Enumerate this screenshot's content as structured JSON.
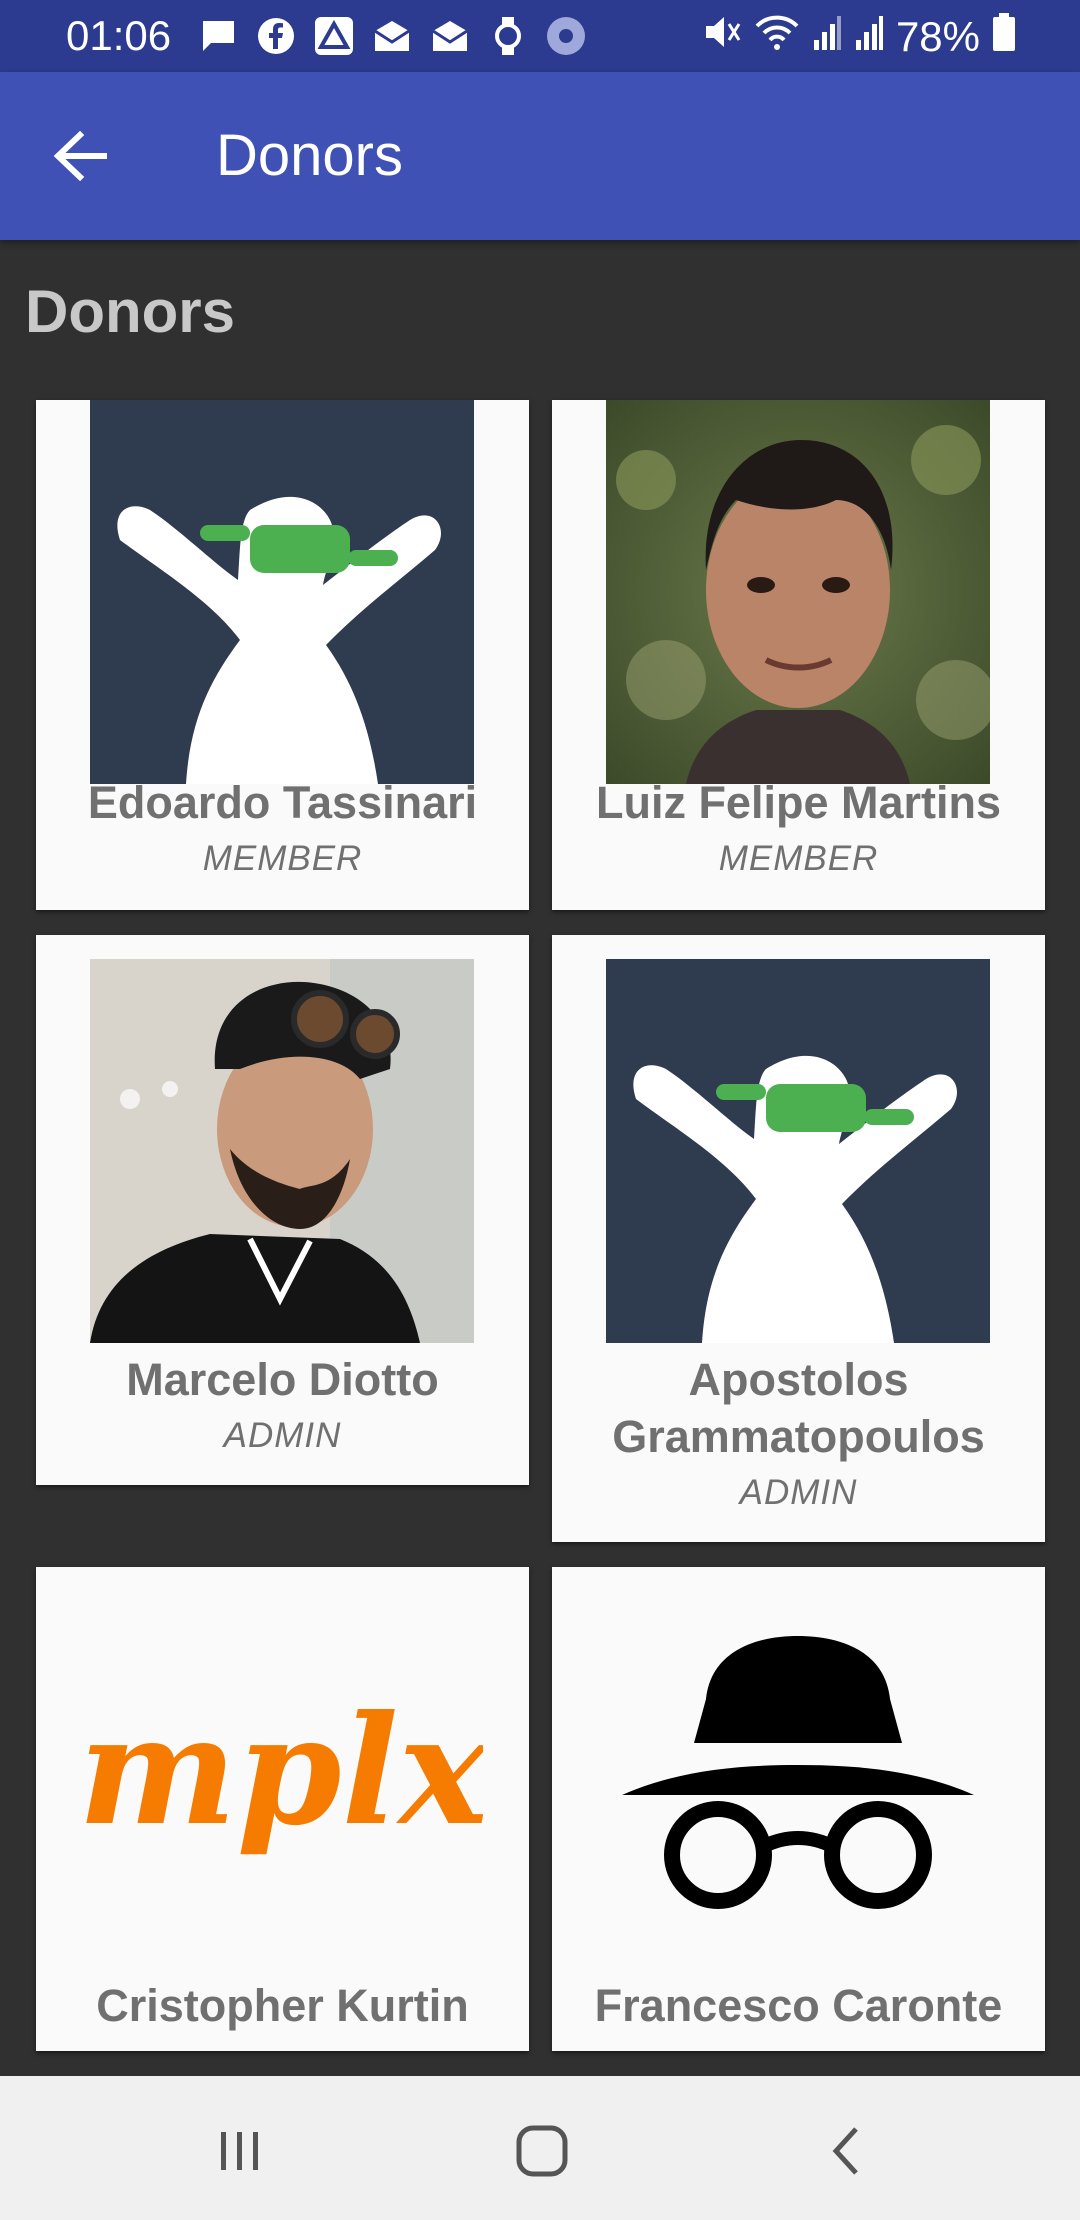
{
  "status_bar": {
    "time": "01:06",
    "battery": "78%",
    "icons_left": [
      "message-icon",
      "facebook-icon",
      "drive-icon",
      "mail-icon",
      "mail-icon",
      "watch-icon",
      "app-icon"
    ],
    "icons_right": [
      "mute-icon",
      "wifi-icon",
      "signal-icon",
      "signal-icon",
      "battery-icon"
    ]
  },
  "app_bar": {
    "title": "Donors",
    "back_icon": "arrow-left-icon"
  },
  "section_title": "Donors",
  "donors": [
    {
      "name": "Edoardo Tassinari",
      "role": "MEMBER",
      "avatar": "default-avatar"
    },
    {
      "name": "Luiz Felipe Martins",
      "role": "MEMBER",
      "avatar": "photo"
    },
    {
      "name": "Marcelo Diotto",
      "role": "ADMIN",
      "avatar": "photo"
    },
    {
      "name": "Apostolos Grammatopoulos",
      "role": "ADMIN",
      "avatar": "default-avatar"
    },
    {
      "name": "Cristopher Kurtin",
      "role": "",
      "avatar": "mplx-logo",
      "logo_text": "mplx"
    },
    {
      "name": "Francesco Caronte",
      "role": "",
      "avatar": "incognito-icon"
    }
  ],
  "colors": {
    "status_bar": "#2c3a8f",
    "app_bar": "#3f51b5",
    "background": "#303030",
    "card": "#fafafa",
    "text_gray": "#707070",
    "avatar_bg": "#2f3b4f",
    "mask_green": "#4caf50",
    "logo_orange": "#f57c00"
  },
  "nav_bar": {
    "buttons": [
      "recent-apps-icon",
      "home-icon",
      "back-icon"
    ]
  }
}
